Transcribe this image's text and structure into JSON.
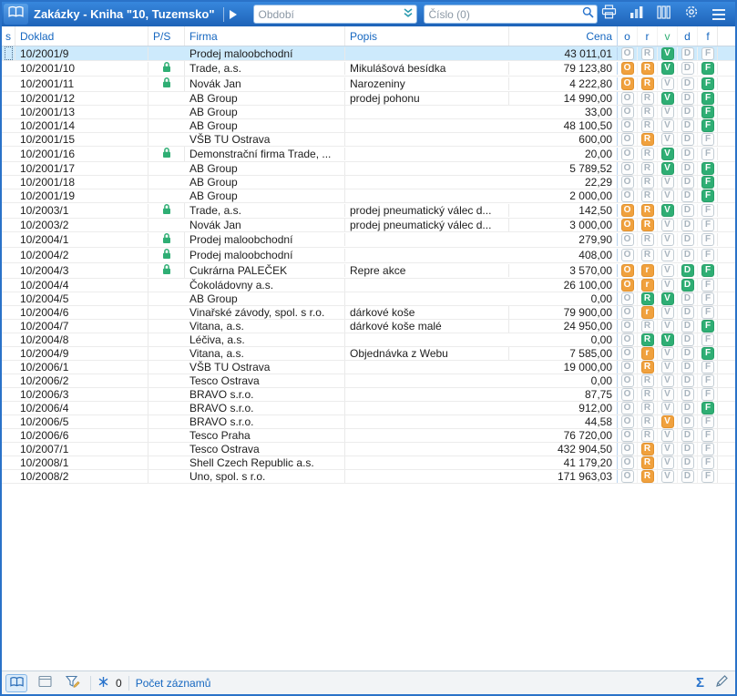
{
  "toolbar": {
    "title": "Zakázky - Kniha \"10, Tuzemsko\"",
    "period_placeholder": "Období",
    "search_placeholder": "Číslo (0)"
  },
  "icons": {
    "sum_glyph": "Σ"
  },
  "table": {
    "header": {
      "s": "s",
      "doklad": "Doklad",
      "ps": "P/S",
      "firma": "Firma",
      "popis": "Popis",
      "cena": "Cena",
      "flags": [
        {
          "letter": "o",
          "color": "#1667c0"
        },
        {
          "letter": "r",
          "color": "#1667c0"
        },
        {
          "letter": "v",
          "color": "#2fae74"
        },
        {
          "letter": "d",
          "color": "#1667c0"
        },
        {
          "letter": "f",
          "color": "#1667c0"
        }
      ]
    },
    "rows": [
      {
        "doklad": "10/2001/9",
        "lock": false,
        "firma": "Prodej maloobchodní",
        "popis": "",
        "cena": "43 011,01",
        "flags": [
          "O-gray",
          "R-gray",
          "V-green",
          "D-gray",
          "F-gray"
        ],
        "selected": true
      },
      {
        "doklad": "10/2001/10",
        "lock": true,
        "firma": "Trade, a.s.",
        "popis": "Mikulášová besídka",
        "cena": "79 123,80",
        "flags": [
          "O-orange",
          "R-orange",
          "V-green",
          "D-gray",
          "F-green"
        ]
      },
      {
        "doklad": "10/2001/11",
        "lock": true,
        "firma": "Novák Jan",
        "popis": "Narozeniny",
        "cena": "4 222,80",
        "flags": [
          "O-orange",
          "R-orange",
          "V-gray",
          "D-gray",
          "F-green"
        ]
      },
      {
        "doklad": "10/2001/12",
        "lock": false,
        "firma": "AB Group",
        "popis": "prodej pohonu",
        "cena": "14 990,00",
        "flags": [
          "O-gray",
          "R-gray",
          "V-green",
          "D-gray",
          "F-green"
        ]
      },
      {
        "doklad": "10/2001/13",
        "lock": false,
        "firma": "AB Group",
        "popis": "",
        "cena": "33,00",
        "flags": [
          "O-gray",
          "R-gray",
          "V-gray",
          "D-gray",
          "F-green"
        ]
      },
      {
        "doklad": "10/2001/14",
        "lock": false,
        "firma": "AB Group",
        "popis": "",
        "cena": "48 100,50",
        "flags": [
          "O-gray",
          "R-gray",
          "V-gray",
          "D-gray",
          "F-green"
        ]
      },
      {
        "doklad": "10/2001/15",
        "lock": false,
        "firma": "VŠB TU Ostrava",
        "popis": "",
        "cena": "600,00",
        "flags": [
          "O-gray",
          "R-orange",
          "V-gray",
          "D-gray",
          "F-gray"
        ]
      },
      {
        "doklad": "10/2001/16",
        "lock": true,
        "firma": "Demonstrační firma Trade, ...",
        "popis": "",
        "cena": "20,00",
        "flags": [
          "O-gray",
          "R-gray",
          "V-green",
          "D-gray",
          "F-gray"
        ]
      },
      {
        "doklad": "10/2001/17",
        "lock": false,
        "firma": "AB Group",
        "popis": "",
        "cena": "5 789,52",
        "flags": [
          "O-gray",
          "R-gray",
          "V-green",
          "D-gray",
          "F-green"
        ]
      },
      {
        "doklad": "10/2001/18",
        "lock": false,
        "firma": "AB Group",
        "popis": "",
        "cena": "22,29",
        "flags": [
          "O-gray",
          "R-gray",
          "V-gray",
          "D-gray",
          "F-green"
        ]
      },
      {
        "doklad": "10/2001/19",
        "lock": false,
        "firma": "AB Group",
        "popis": "",
        "cena": "2 000,00",
        "flags": [
          "O-gray",
          "R-gray",
          "V-gray",
          "D-gray",
          "F-green"
        ]
      },
      {
        "doklad": "10/2003/1",
        "lock": true,
        "firma": "Trade, a.s.",
        "popis": "prodej pneumatický válec d...",
        "cena": "142,50",
        "flags": [
          "O-orange",
          "R-orange",
          "V-green",
          "D-gray",
          "F-gray"
        ]
      },
      {
        "doklad": "10/2003/2",
        "lock": false,
        "firma": "Novák Jan",
        "popis": "prodej pneumatický válec d...",
        "cena": "3 000,00",
        "flags": [
          "O-orange",
          "R-orange",
          "V-gray",
          "D-gray",
          "F-gray"
        ]
      },
      {
        "doklad": "10/2004/1",
        "lock": true,
        "firma": "Prodej maloobchodní",
        "popis": "",
        "cena": "279,90",
        "flags": [
          "O-gray",
          "R-gray",
          "V-gray",
          "D-gray",
          "F-gray"
        ]
      },
      {
        "doklad": "10/2004/2",
        "lock": true,
        "firma": "Prodej maloobchodní",
        "popis": "",
        "cena": "408,00",
        "flags": [
          "O-gray",
          "R-gray",
          "V-gray",
          "D-gray",
          "F-gray"
        ]
      },
      {
        "doklad": "10/2004/3",
        "lock": true,
        "firma": "Cukrárna PALEČEK",
        "popis": "Repre akce",
        "cena": "3 570,00",
        "flags": [
          "O-orange",
          "r-orange",
          "V-gray",
          "D-green",
          "F-green"
        ]
      },
      {
        "doklad": "10/2004/4",
        "lock": false,
        "firma": "Čokoládovny a.s.",
        "popis": "",
        "cena": "26 100,00",
        "flags": [
          "O-orange",
          "r-orange",
          "V-gray",
          "D-green",
          "F-gray"
        ]
      },
      {
        "doklad": "10/2004/5",
        "lock": false,
        "firma": "AB Group",
        "popis": "",
        "cena": "0,00",
        "flags": [
          "O-gray",
          "R-green",
          "V-green",
          "D-gray",
          "F-gray"
        ]
      },
      {
        "doklad": "10/2004/6",
        "lock": false,
        "firma": "Vinařské závody, spol. s r.o.",
        "popis": "dárkové koše",
        "cena": "79 900,00",
        "flags": [
          "O-gray",
          "r-orange",
          "V-gray",
          "D-gray",
          "F-gray"
        ]
      },
      {
        "doklad": "10/2004/7",
        "lock": false,
        "firma": "Vitana, a.s.",
        "popis": "dárkové koše malé",
        "cena": "24 950,00",
        "flags": [
          "O-gray",
          "R-gray",
          "V-gray",
          "D-gray",
          "F-green"
        ]
      },
      {
        "doklad": "10/2004/8",
        "lock": false,
        "firma": "Léčiva, a.s.",
        "popis": "",
        "cena": "0,00",
        "flags": [
          "O-gray",
          "R-green",
          "V-green",
          "D-gray",
          "F-gray"
        ]
      },
      {
        "doklad": "10/2004/9",
        "lock": false,
        "firma": "Vitana, a.s.",
        "popis": "Objednávka z Webu",
        "cena": "7 585,00",
        "flags": [
          "O-gray",
          "r-orange",
          "V-gray",
          "D-gray",
          "F-green"
        ]
      },
      {
        "doklad": "10/2006/1",
        "lock": false,
        "firma": "VŠB TU Ostrava",
        "popis": "",
        "cena": "19 000,00",
        "flags": [
          "O-gray",
          "R-orange",
          "V-gray",
          "D-gray",
          "F-gray"
        ]
      },
      {
        "doklad": "10/2006/2",
        "lock": false,
        "firma": "Tesco Ostrava",
        "popis": "",
        "cena": "0,00",
        "flags": [
          "O-gray",
          "R-gray",
          "V-gray",
          "D-gray",
          "F-gray"
        ]
      },
      {
        "doklad": "10/2006/3",
        "lock": false,
        "firma": "BRAVO s.r.o.",
        "popis": "",
        "cena": "87,75",
        "flags": [
          "O-gray",
          "R-gray",
          "V-gray",
          "D-gray",
          "F-gray"
        ]
      },
      {
        "doklad": "10/2006/4",
        "lock": false,
        "firma": "BRAVO s.r.o.",
        "popis": "",
        "cena": "912,00",
        "flags": [
          "O-gray",
          "R-gray",
          "V-gray",
          "D-gray",
          "F-green"
        ]
      },
      {
        "doklad": "10/2006/5",
        "lock": false,
        "firma": "BRAVO s.r.o.",
        "popis": "",
        "cena": "44,58",
        "flags": [
          "O-gray",
          "R-gray",
          "V-orange",
          "D-gray",
          "F-gray"
        ]
      },
      {
        "doklad": "10/2006/6",
        "lock": false,
        "firma": "Tesco Praha",
        "popis": "",
        "cena": "76 720,00",
        "flags": [
          "O-gray",
          "R-gray",
          "V-gray",
          "D-gray",
          "F-gray"
        ]
      },
      {
        "doklad": "10/2007/1",
        "lock": false,
        "firma": "Tesco Ostrava",
        "popis": "",
        "cena": "432 904,50",
        "flags": [
          "O-gray",
          "R-orange",
          "V-gray",
          "D-gray",
          "F-gray"
        ]
      },
      {
        "doklad": "10/2008/1",
        "lock": false,
        "firma": "Shell Czech Republic a.s.",
        "popis": "",
        "cena": "41 179,20",
        "flags": [
          "O-gray",
          "R-orange",
          "V-gray",
          "D-gray",
          "F-gray"
        ]
      },
      {
        "doklad": "10/2008/2",
        "lock": false,
        "firma": "Uno, spol. s r.o.",
        "popis": "",
        "cena": "171 963,03",
        "flags": [
          "O-gray",
          "R-orange",
          "V-gray",
          "D-gray",
          "F-gray"
        ]
      }
    ]
  },
  "statusbar": {
    "zero_count": "0",
    "records_label": "Počet záznamů"
  },
  "colors": {
    "accent_blue": "#2873cc",
    "header_blue": "#1667c0",
    "flag_orange": "#f0a13e",
    "flag_green": "#2fae74",
    "selected_row": "#cdeafc",
    "toolbar_gradient_top": "#3787dd",
    "toolbar_gradient_bottom": "#1e63b8"
  }
}
